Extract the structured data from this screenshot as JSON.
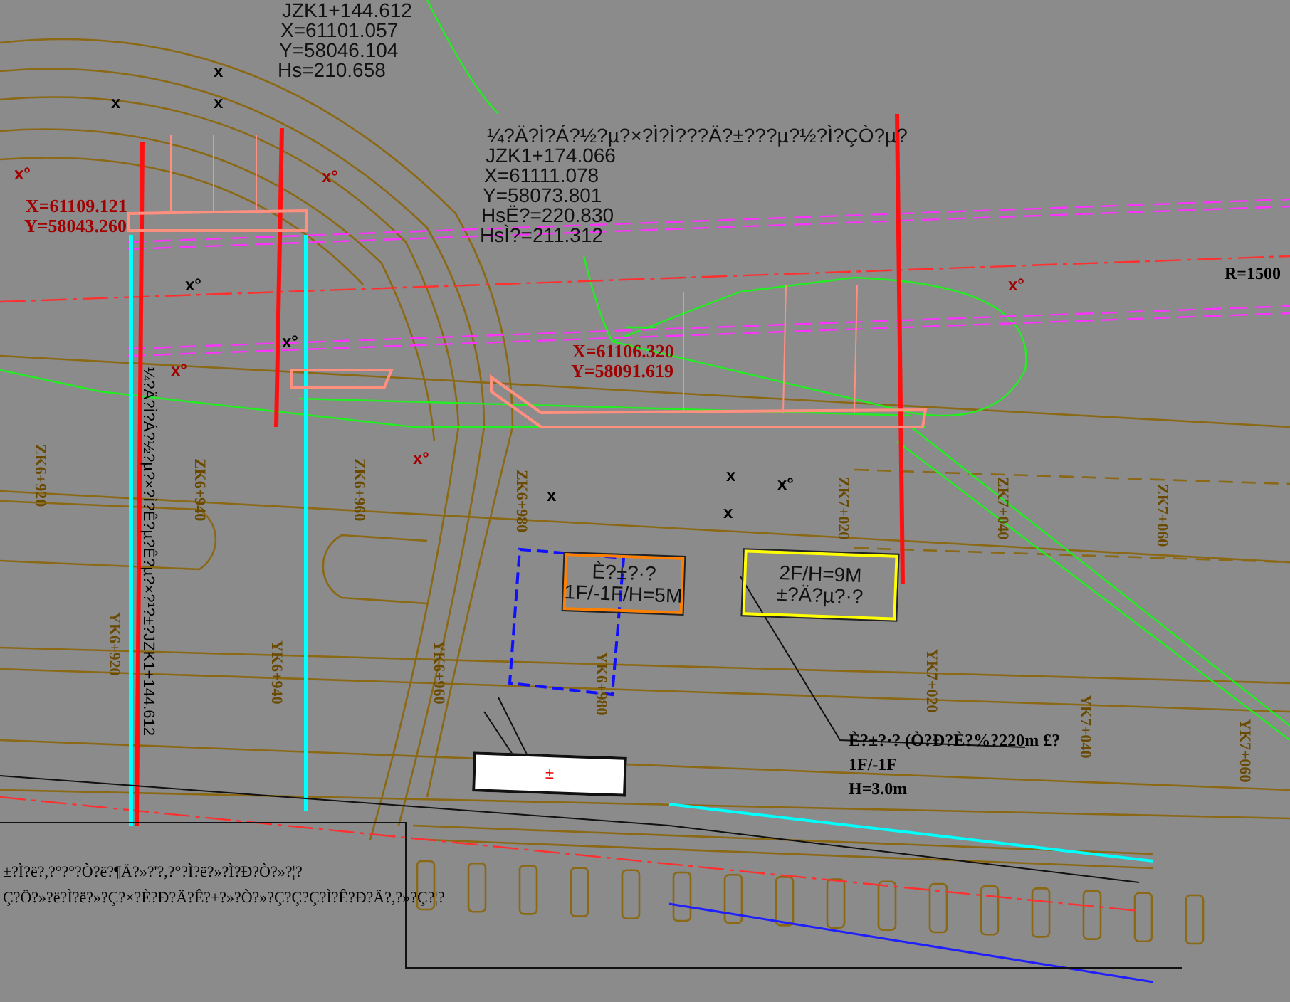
{
  "drawing": {
    "callouts": [
      {
        "kind": "survey",
        "lines": [
          "JZK1+144.612",
          "X=61101.057",
          "Y=58046.104",
          "Hs=210.658"
        ]
      },
      {
        "kind": "survey",
        "lines": [
          "¼?Ä?Ì?Á?½?µ?×?Ì?Ì???Ä?±???µ?½?Ì?ÇÒ?µ?",
          "JZK1+174.066",
          "X=61111.078",
          "Y=58073.801",
          "HsË?=220.830",
          "HsÌ?=211.312"
        ]
      },
      {
        "kind": "point",
        "lines": [
          "X=61109.121",
          "Y=58043.260"
        ]
      },
      {
        "kind": "point",
        "lines": [
          "X=61106.320",
          "Y=58091.619"
        ]
      }
    ],
    "radius_label": "R=1500",
    "vertical_note": "¼?Ä?Ì?Á?½?µ?×?Ì?Ê?µ?Ê?µ?×?¹?±?JZK1+144.612",
    "stations": [
      "ZK6+920",
      "ZK6+940",
      "ZK6+960",
      "ZK6+980",
      "ZK7+020",
      "ZK7+040",
      "ZK7+060",
      "YK6+920",
      "YK6+940",
      "YK6+960",
      "YK6+980",
      "YK7+020",
      "YK7+040",
      "YK7+060"
    ],
    "marks": [
      {
        "text": "x",
        "color": "#000000"
      },
      {
        "text": "x",
        "color": "#000000"
      },
      {
        "text": "x",
        "color": "#000000"
      },
      {
        "text": "x°",
        "color": "#000000"
      },
      {
        "text": "x°",
        "color": "#a00000"
      },
      {
        "text": "x°",
        "color": "#a00000"
      },
      {
        "text": "x°",
        "color": "#a00000"
      },
      {
        "text": "x°",
        "color": "#a00000"
      },
      {
        "text": "x°",
        "color": "#a00000"
      },
      {
        "text": "x°",
        "color": "#000000"
      },
      {
        "text": "x°",
        "color": "#000000"
      },
      {
        "text": "x",
        "color": "#000000"
      },
      {
        "text": "x",
        "color": "#000000"
      },
      {
        "text": "x",
        "color": "#000000"
      }
    ],
    "buildings": [
      {
        "lines": [
          "È?±?·?",
          "1F/-1F/H=5M"
        ],
        "highlighted": false
      },
      {
        "lines": [
          "2F/H=9M",
          "±?Ä?µ?·?"
        ],
        "highlighted": true
      }
    ],
    "building_note": [
      "È?±?·? (Ò?Ð?È?%?220m £?",
      "1F/-1F",
      "H=3.0m"
    ],
    "legend_box": "±",
    "notes": [
      "±?Ì?ë?,?°?°?Ò?ë?¶Ä?»?'?,?°?Ì?ë?»?Ì?Ð?Ò?»?¦?",
      "Ç?Ö?»?ë?Ì?ë?»?Ç?×?È?Ð?Ä?Ê?±?»?Ò?»?Ç?Ç?Ç?Ì?Ê?Ð?Ä?,?»?Ç?¦?"
    ]
  }
}
